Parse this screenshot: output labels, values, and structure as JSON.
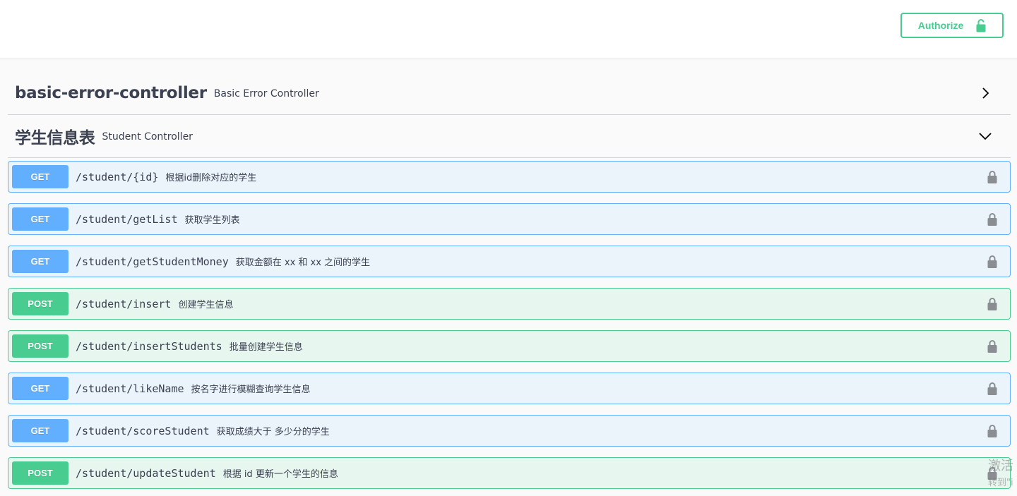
{
  "header": {
    "authorize_label": "Authorize",
    "authorize_icon": "lock-open-icon",
    "accent": "#49cc90"
  },
  "tags": [
    {
      "title": "basic-error-controller",
      "description": "Basic Error Controller",
      "state": "collapsed",
      "arrow_icon": "chevron-right-icon"
    },
    {
      "title": "学生信息表",
      "description": "Student Controller",
      "state": "expanded",
      "arrow_icon": "chevron-down-icon"
    }
  ],
  "operations": [
    {
      "method": "GET",
      "path": "/student/{id}",
      "summary": "根据id删除对应的学生"
    },
    {
      "method": "GET",
      "path": "/student/getList",
      "summary": "获取学生列表"
    },
    {
      "method": "GET",
      "path": "/student/getStudentMoney",
      "summary": "获取金额在 xx 和 xx 之间的学生"
    },
    {
      "method": "POST",
      "path": "/student/insert",
      "summary": "创建学生信息"
    },
    {
      "method": "POST",
      "path": "/student/insertStudents",
      "summary": "批量创建学生信息"
    },
    {
      "method": "GET",
      "path": "/student/likeName",
      "summary": "按名字进行模糊查询学生信息"
    },
    {
      "method": "GET",
      "path": "/student/scoreStudent",
      "summary": "获取成绩大于 多少分的学生"
    },
    {
      "method": "POST",
      "path": "/student/updateStudent",
      "summary": "根据 id 更新一个学生的信息"
    }
  ],
  "colors": {
    "get": "#61affe",
    "post": "#49cc90",
    "text": "#3b4151",
    "lock": "#8a8d92"
  },
  "watermark": {
    "line1": "激活",
    "line2": "转到\"i"
  }
}
